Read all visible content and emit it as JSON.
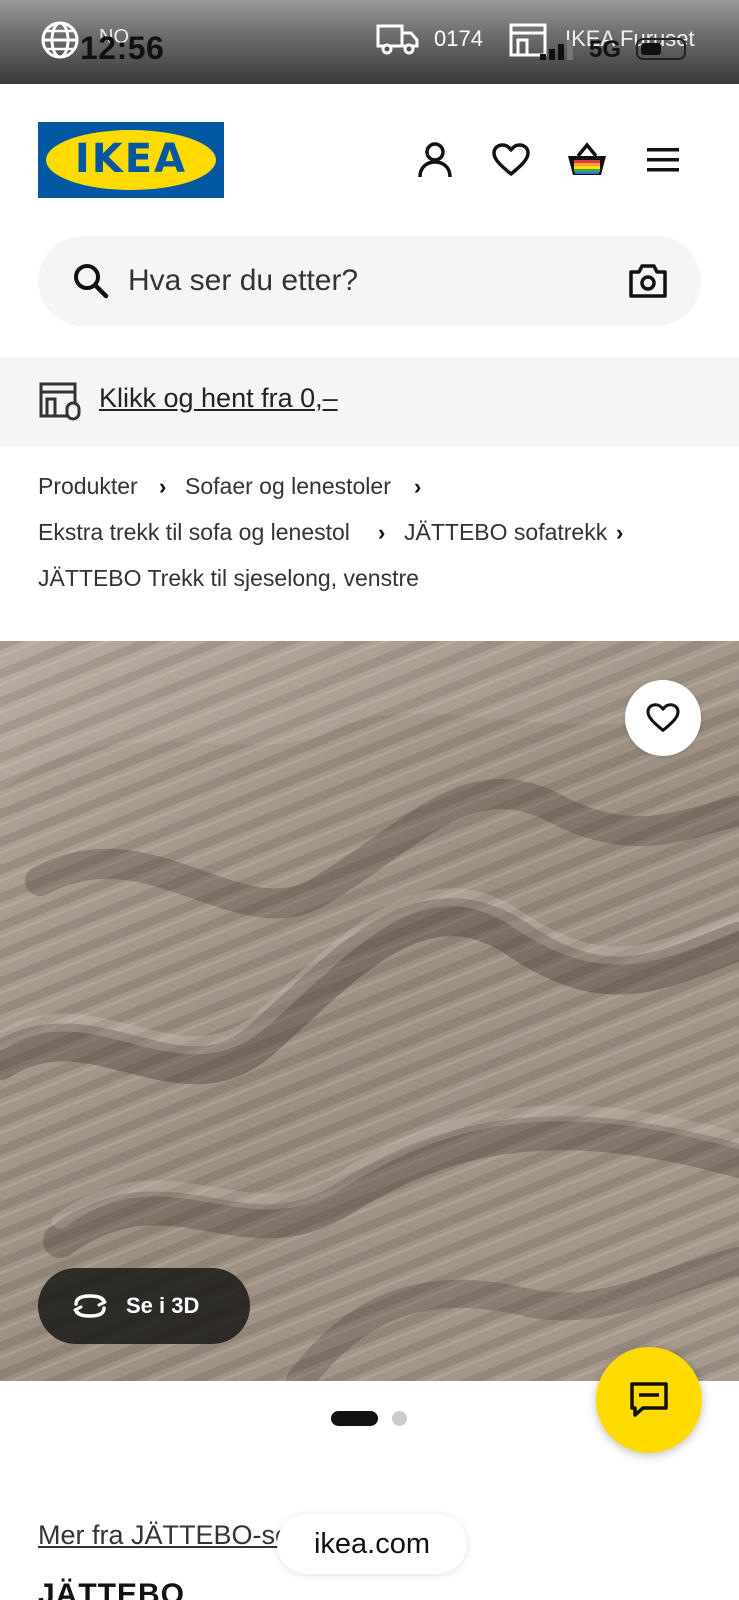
{
  "status_bar": {
    "time": "12:56",
    "country": "NO",
    "postcode": "0174",
    "store": "IKEA Furuset",
    "network": "5G"
  },
  "header": {
    "logo_text": "IKEA",
    "icons": [
      "user-icon",
      "heart-icon",
      "basket-icon",
      "menu-icon"
    ]
  },
  "search": {
    "placeholder": "Hva ser du etter?"
  },
  "banner": {
    "text": "Klikk og hent fra 0,–"
  },
  "breadcrumb": {
    "items": [
      "Produkter",
      "Sofaer og lenestoler",
      "Ekstra trekk til sofa og lenestol",
      "JÄTTEBO sofatrekk",
      "JÄTTEBO Trekk til sjeselong, venstre"
    ]
  },
  "gallery": {
    "view_3d_label": "Se i 3D",
    "pages": 2,
    "current_page": 1
  },
  "product": {
    "series_link": "Mer fra JÄTTEBO-serien",
    "name": "JÄTTEBO"
  },
  "browser": {
    "url": "ikea.com"
  },
  "colors": {
    "ikea_blue": "#0058a3",
    "ikea_yellow": "#ffdb00",
    "fabric": "#a4978a"
  }
}
